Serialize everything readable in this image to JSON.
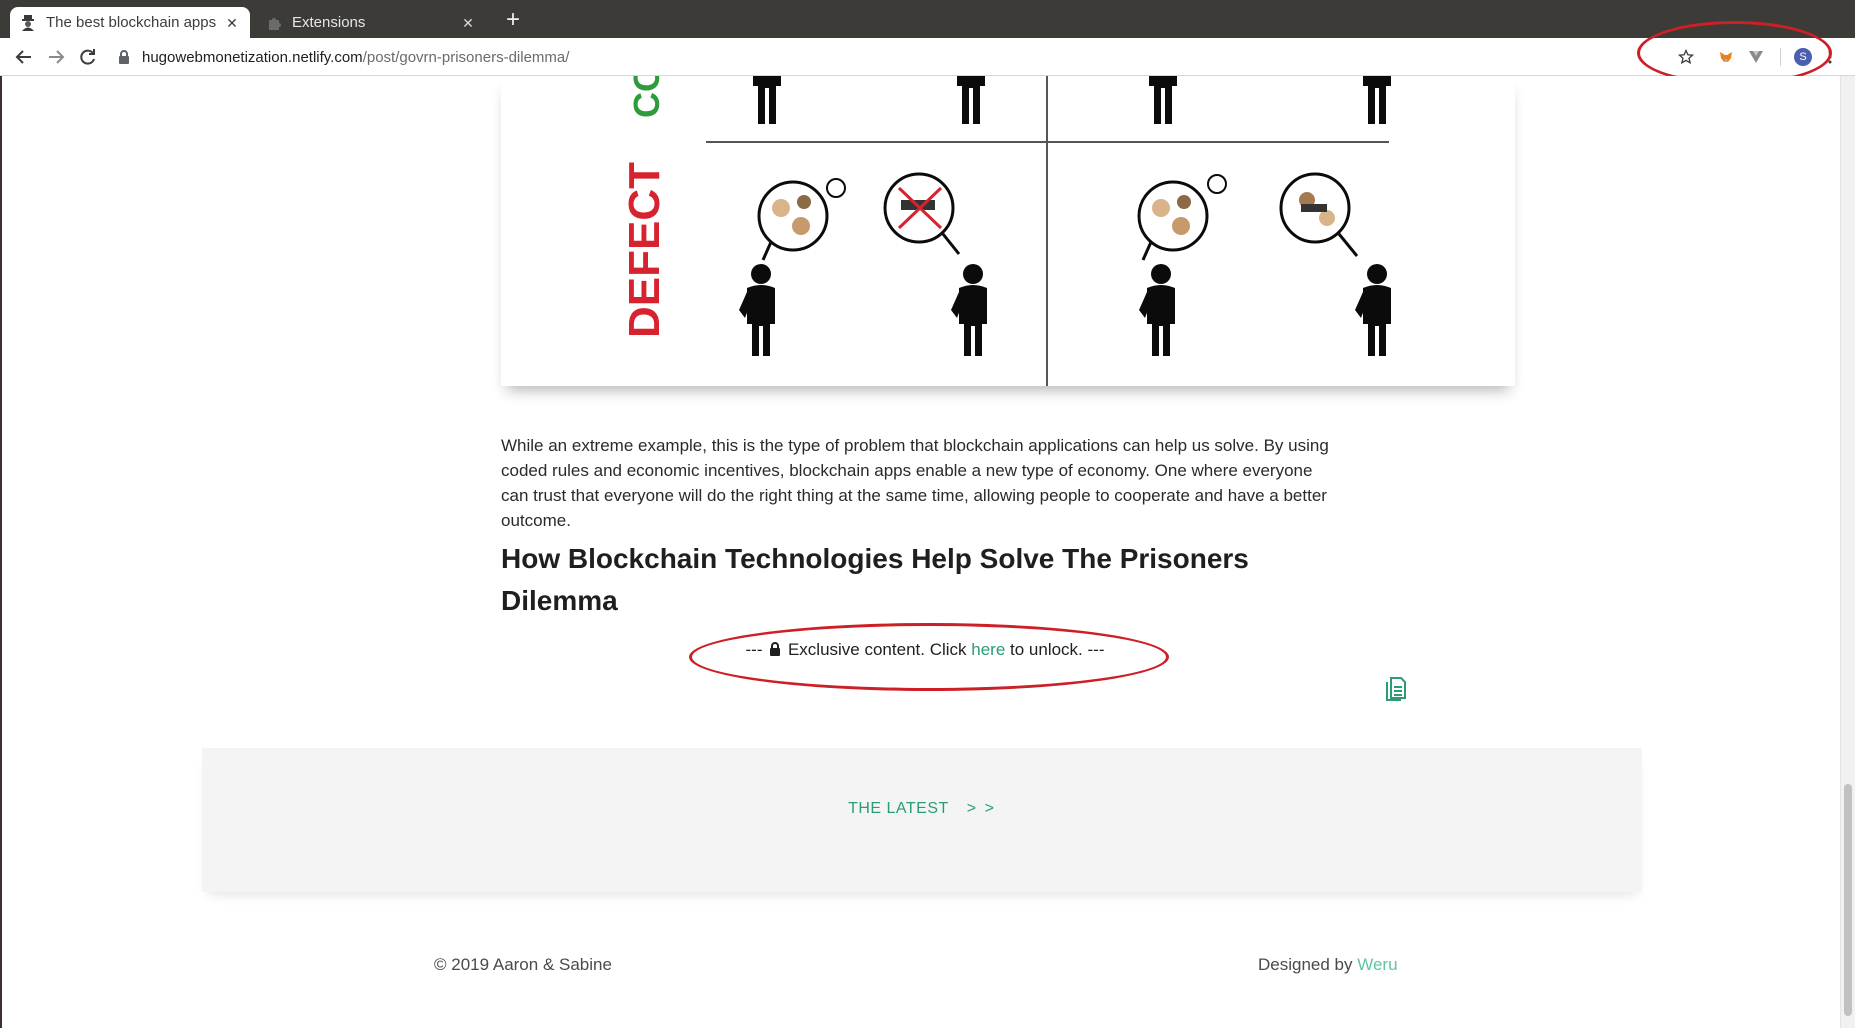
{
  "browser": {
    "tabs": [
      {
        "title": "The best blockchain apps",
        "active": true
      },
      {
        "title": "Extensions",
        "active": false
      }
    ],
    "new_tab_symbol": "+",
    "close_symbol": "✕",
    "url_host": "hugowebmonetization.netlify.com",
    "url_path": "/post/govrn-prisoners-dilemma/",
    "profile_initial": "S"
  },
  "figure": {
    "row_label_cooperate": "CO",
    "row_label_defect": "DEFECT"
  },
  "article": {
    "paragraph": "While an extreme example, this is the type of problem that blockchain applications can help us solve. By using coded rules and economic incentives, blockchain apps enable a new type of economy. One where everyone can trust that everyone will do the right thing at the same time, allowing people to cooperate and have a better outcome.",
    "heading": "How Blockchain Technologies Help Solve The Prisoners Dilemma",
    "exclusive_prefix": "--- ",
    "exclusive_mid": " Exclusive content. Click ",
    "exclusive_link": "here",
    "exclusive_suffix": " to unlock. ---"
  },
  "nav": {
    "latest_label": "THE LATEST",
    "latest_chevrons": "> >"
  },
  "footer": {
    "copyright": "© 2019 Aaron & Sabine",
    "designed_by": "Designed by ",
    "designer": "Weru"
  },
  "colors": {
    "accent": "#2a9d73",
    "annotation_red": "#cc1f26",
    "cooperate_green": "#2e9b3c",
    "defect_red": "#d7232f"
  }
}
